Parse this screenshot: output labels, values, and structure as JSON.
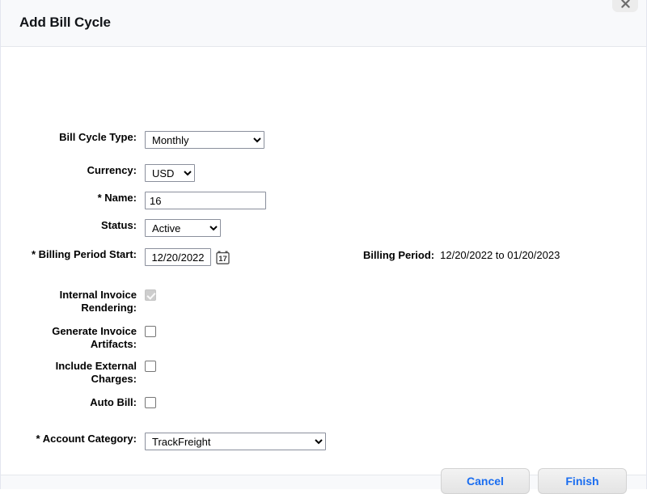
{
  "dialog": {
    "title": "Add Bill Cycle",
    "close_icon": "close-icon"
  },
  "form": {
    "bill_cycle_type": {
      "label": "Bill Cycle Type:",
      "value": "Monthly",
      "options": [
        "Monthly"
      ]
    },
    "currency": {
      "label": "Currency:",
      "value": "USD",
      "options": [
        "USD"
      ]
    },
    "name": {
      "label": "* Name:",
      "value": "16",
      "placeholder": ""
    },
    "status": {
      "label": "Status:",
      "value": "Active",
      "options": [
        "Active"
      ]
    },
    "billing_period_start": {
      "label": "* Billing Period Start:",
      "value": "12/20/2022",
      "calendar_icon_day": "17"
    },
    "billing_period_summary": {
      "label": "Billing Period:",
      "value": "12/20/2022 to 01/20/2023"
    },
    "internal_invoice_rendering": {
      "label": "Internal Invoice\nRendering:",
      "checked": true,
      "disabled": true
    },
    "generate_invoice_artifacts": {
      "label": "Generate Invoice\nArtifacts:",
      "checked": false,
      "disabled": false
    },
    "include_external_charges": {
      "label": "Include External\nCharges:",
      "checked": false,
      "disabled": false
    },
    "auto_bill": {
      "label": "Auto Bill:",
      "checked": false,
      "disabled": false
    },
    "account_category": {
      "label": "* Account Category:",
      "value": "TrackFreight",
      "options": [
        "TrackFreight"
      ]
    }
  },
  "actions": {
    "cancel_label": "Cancel",
    "finish_label": "Finish"
  },
  "colors": {
    "accent_blue": "#1a6df0",
    "header_bg": "#f8f9fb",
    "field_border": "#8a8f9c"
  }
}
